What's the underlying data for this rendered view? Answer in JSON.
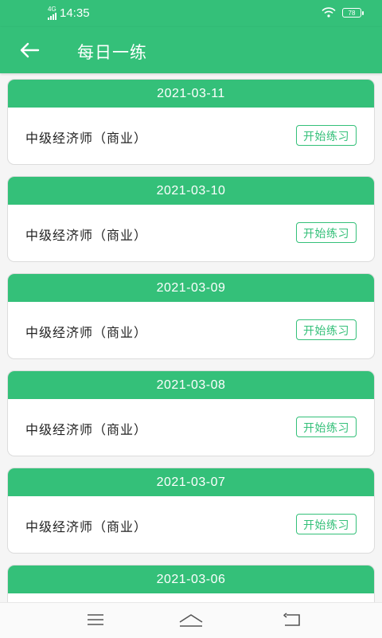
{
  "status": {
    "time": "14:35",
    "network": "4G",
    "battery": "78"
  },
  "header": {
    "title": "每日一练"
  },
  "colors": {
    "accent": "#34c079"
  },
  "icons": {
    "back": "arrow-left-icon",
    "menu": "menu-icon",
    "home": "home-icon",
    "return": "return-icon"
  },
  "items": [
    {
      "date": "2021-03-11",
      "course": "中级经济师（商业）",
      "action": "开始练习"
    },
    {
      "date": "2021-03-10",
      "course": "中级经济师（商业）",
      "action": "开始练习"
    },
    {
      "date": "2021-03-09",
      "course": "中级经济师（商业）",
      "action": "开始练习"
    },
    {
      "date": "2021-03-08",
      "course": "中级经济师（商业）",
      "action": "开始练习"
    },
    {
      "date": "2021-03-07",
      "course": "中级经济师（商业）",
      "action": "开始练习"
    },
    {
      "date": "2021-03-06",
      "course": "",
      "action": ""
    }
  ]
}
